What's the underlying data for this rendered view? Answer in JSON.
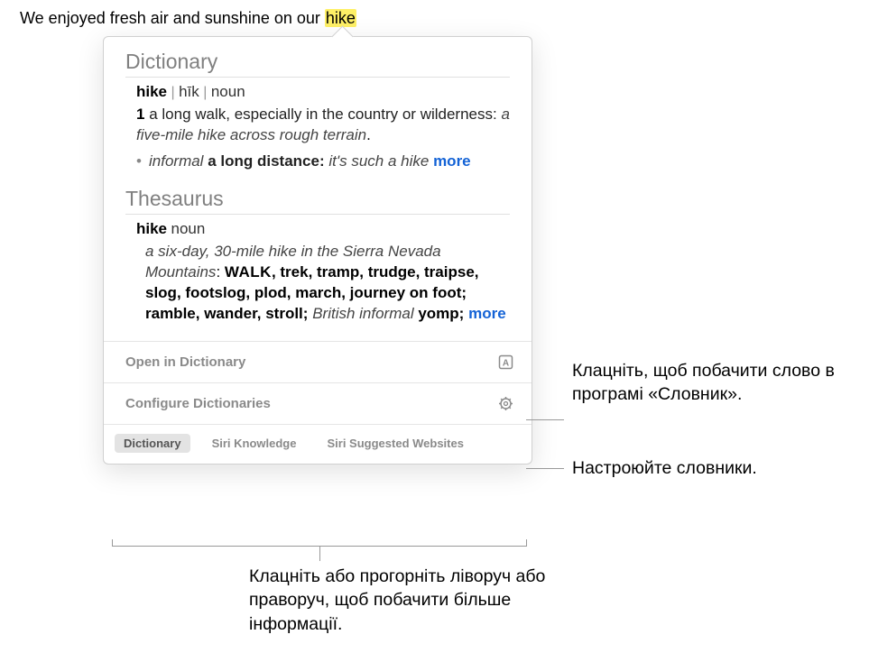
{
  "sentence": {
    "before": "We enjoyed fresh air and sunshine on our ",
    "highlighted": "hike"
  },
  "dictionary": {
    "header": "Dictionary",
    "word": "hike",
    "pronunciation": "hīk",
    "pos": "noun",
    "def_num": "1",
    "def_text": "a long walk, especially in the country or wilderness:",
    "def_example": "a five-mile hike across rough terrain",
    "sub_label": "informal",
    "sub_def": "a long distance:",
    "sub_example": "it's such a hike",
    "more": "more"
  },
  "thesaurus": {
    "header": "Thesaurus",
    "word": "hike",
    "pos": "noun",
    "example": "a six-day, 30-mile hike in the Sierra Nevada Mountains",
    "synonym_main": "WALK",
    "synonyms_rest": ", trek, tramp, trudge, traipse, slog, footslog, plod, march, journey on foot; ramble, wander, stroll;",
    "regional_label": "British informal",
    "regional_word": "yomp;",
    "more": "more"
  },
  "actions": {
    "open": "Open in Dictionary",
    "configure": "Configure Dictionaries"
  },
  "tabs": {
    "dictionary": "Dictionary",
    "siri_knowledge": "Siri Knowledge",
    "siri_websites": "Siri Suggested Websites"
  },
  "callouts": {
    "open": "Клацніть, щоб побачити слово в програмі «Словник».",
    "configure": "Настроюйте словники.",
    "tabs": "Клацніть або прогорніть ліворуч або праворуч, щоб побачити більше інформації."
  }
}
